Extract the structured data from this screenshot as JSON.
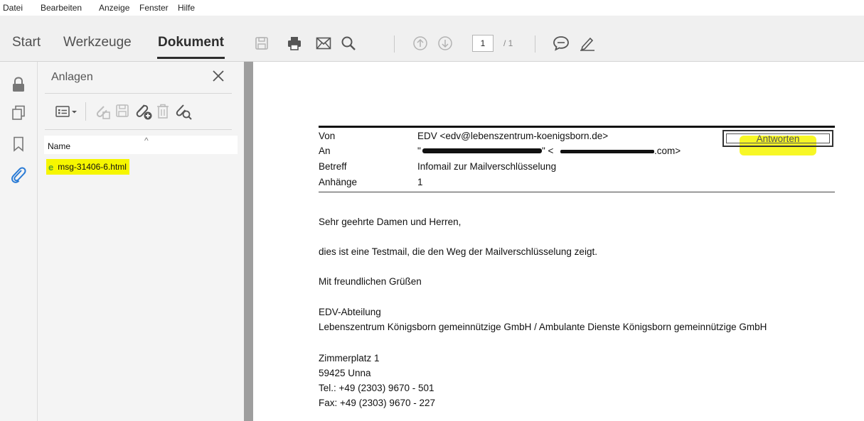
{
  "menu": [
    "Datei",
    "Bearbeiten",
    "Anzeige",
    "Fenster",
    "Hilfe"
  ],
  "tabs": {
    "start": "Start",
    "tools": "Werkzeuge",
    "document": "Dokument"
  },
  "page_nav": {
    "current": "1",
    "total": "/ 1"
  },
  "attachments": {
    "title": "Anlagen",
    "column_name": "Name",
    "sort_indicator": "^",
    "files": [
      {
        "name": "msg-31406-6.html"
      }
    ]
  },
  "email": {
    "labels": {
      "from": "Von",
      "to": "An",
      "subject": "Betreff",
      "attachments": "Anhänge"
    },
    "from": "EDV <edv@lebenszentrum-koenigsborn.de>",
    "to_prefix": "\"",
    "to_mid": "\" <",
    "to_suffix": ".com>",
    "subject": "Infomail zur Mailverschlüsselung",
    "attachment_count": "1",
    "reply_button": "Antworten",
    "body": {
      "greeting": "Sehr geehrte Damen und Herren,",
      "line1": "dies ist eine Testmail, die den Weg der Mailverschlüsselung zeigt.",
      "closing": "Mit freundlichen Grüßen",
      "sig_dept": "EDV-Abteilung",
      "sig_org": "Lebenszentrum Königsborn gemeinnützige GmbH / Ambulante Dienste Königsborn gemeinnützige GmbH",
      "street": "Zimmerplatz 1",
      "city": "59425 Unna",
      "tel": "Tel.: +49 (2303) 9670 - 501",
      "fax": "Fax: +49 (2303) 9670 - 227"
    }
  },
  "colors": {
    "highlight": "#f6f600",
    "toolbar_bg": "#f0f0f0",
    "splitter": "#9e9e9e",
    "attachment_blue": "#2a7bd5"
  }
}
